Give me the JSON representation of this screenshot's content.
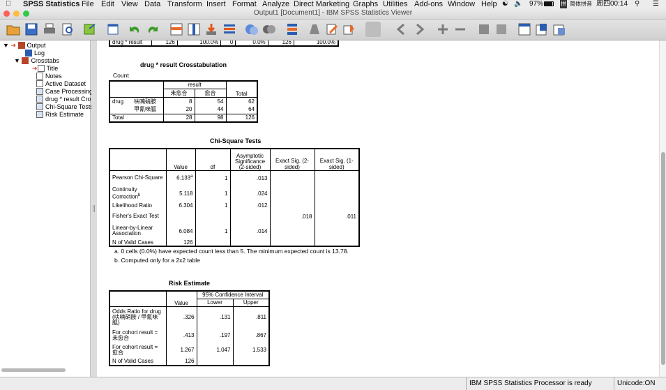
{
  "menubar": {
    "app": "SPSS Statistics",
    "items": [
      "File",
      "Edit",
      "View",
      "Data",
      "Transform",
      "Insert",
      "Format",
      "Analyze",
      "Direct Marketing",
      "Graphs",
      "Utilities",
      "Add-ons",
      "Window",
      "Help"
    ],
    "battery": "97%",
    "input_method": "简体拼音",
    "clock": "周四00:14"
  },
  "window": {
    "title": "Output1 [Document1] - IBM SPSS Statistics Viewer"
  },
  "toolbar": {
    "icons": [
      "open-icon",
      "save-icon",
      "print-icon",
      "print-preview-icon",
      "export-icon",
      "recall-dialog-icon",
      "undo-icon",
      "redo-icon",
      "goto-case-icon",
      "goto-variable-icon",
      "import-icon",
      "variables-icon",
      "chart-builder-icon",
      "chart-icon",
      "split-file-icon",
      "weight-cases-icon",
      "select-cases-icon",
      "value-labels-icon",
      "spellcheck-icon",
      "designate-window-icon",
      "previous-icon",
      "next-icon",
      "expand-icon",
      "collapse-icon",
      "show-icon",
      "hide-icon",
      "insert-heading-icon",
      "insert-title-icon",
      "insert-text-icon"
    ]
  },
  "outline": {
    "root": "Output",
    "items": [
      {
        "label": "Log",
        "level": 1,
        "icon": "log-icon"
      },
      {
        "label": "Crosstabs",
        "level": 1,
        "icon": "procedure-icon"
      },
      {
        "label": "Title",
        "level": 2,
        "icon": "title-icon"
      },
      {
        "label": "Notes",
        "level": 2,
        "icon": "notes-icon"
      },
      {
        "label": "Active Dataset",
        "level": 2,
        "icon": "dataset-icon"
      },
      {
        "label": "Case Processing",
        "level": 2,
        "icon": "table-icon"
      },
      {
        "label": "drug * result Cro",
        "level": 2,
        "icon": "table-icon"
      },
      {
        "label": "Chi-Square Tests",
        "level": 2,
        "icon": "table-icon"
      },
      {
        "label": "Risk Estimate",
        "level": 2,
        "icon": "table-icon"
      }
    ]
  },
  "prev_table_row": {
    "label": "drug * result",
    "c1": "126",
    "c2": "100.0%",
    "c3": "0",
    "c4": "0.0%",
    "c5": "126",
    "c6": "100.0%"
  },
  "crosstab": {
    "title": "drug * result Crosstabulation",
    "sub": "Count",
    "col_group": "result",
    "cols": [
      "未愈合",
      "愈合",
      "Total"
    ],
    "row_var": "drug",
    "rows": [
      {
        "label": "呋喃硝胺",
        "values": [
          "8",
          "54",
          "62"
        ]
      },
      {
        "label": "甲氰咪胍",
        "values": [
          "20",
          "44",
          "64"
        ]
      }
    ],
    "total": {
      "label": "Total",
      "values": [
        "28",
        "98",
        "126"
      ]
    }
  },
  "chisq": {
    "title": "Chi-Square Tests",
    "headers": [
      "Value",
      "df",
      "Asymptotic Significance (2-sided)",
      "Exact Sig. (2-sided)",
      "Exact Sig. (1-sided)"
    ],
    "rows": [
      {
        "label": "Pearson Chi-Square",
        "value": "6.133",
        "sup": "a",
        "df": "1",
        "asym": ".013",
        "ex2": "",
        "ex1": ""
      },
      {
        "label": "Continuity Correction",
        "sup2": "b",
        "value": "5.118",
        "df": "1",
        "asym": ".024",
        "ex2": "",
        "ex1": ""
      },
      {
        "label": "Likelihood Ratio",
        "value": "6.304",
        "df": "1",
        "asym": ".012",
        "ex2": "",
        "ex1": ""
      },
      {
        "label": "Fisher's Exact Test",
        "value": "",
        "df": "",
        "asym": "",
        "ex2": ".018",
        "ex1": ".011"
      },
      {
        "label": "Linear-by-Linear Association",
        "value": "6.084",
        "df": "1",
        "asym": ".014",
        "ex2": "",
        "ex1": ""
      },
      {
        "label": "N of Valid Cases",
        "value": "126",
        "df": "",
        "asym": "",
        "ex2": "",
        "ex1": ""
      }
    ],
    "footnotes": [
      "a. 0 cells (0.0%) have expected count less than 5. The minimum expected count is 13.78.",
      "b. Computed only for a 2x2 table"
    ]
  },
  "risk": {
    "title": "Risk Estimate",
    "ci_header": "95% Confidence Interval",
    "headers": [
      "Value",
      "Lower",
      "Upper"
    ],
    "rows": [
      {
        "label": "Odds Ratio for drug (呋喃硝胺 / 甲氰咪胍)",
        "value": ".326",
        "lower": ".131",
        "upper": ".811"
      },
      {
        "label": "For cohort result = 未愈合",
        "value": ".413",
        "lower": ".197",
        "upper": ".867"
      },
      {
        "label": "For cohort result = 愈合",
        "value": "1.267",
        "lower": "1.047",
        "upper": "1.533"
      },
      {
        "label": "N of Valid Cases",
        "value": "126",
        "lower": "",
        "upper": ""
      }
    ]
  },
  "status": {
    "message": "IBM SPSS Statistics Processor is ready",
    "encoding": "Unicode:ON"
  },
  "colors": {
    "close": "#fc605b",
    "minimize": "#fdbc40",
    "zoom": "#34c84a"
  }
}
